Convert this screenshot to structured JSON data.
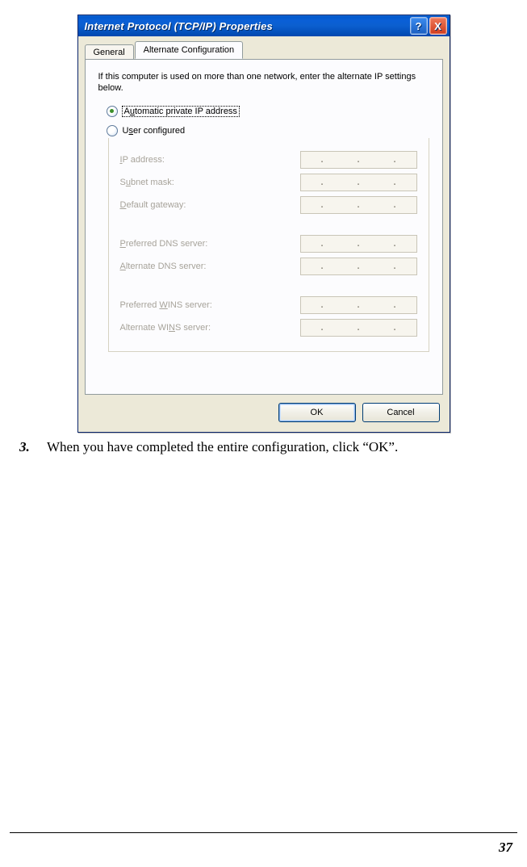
{
  "dialog": {
    "title": "Internet Protocol (TCP/IP) Properties",
    "help_btn": "?",
    "close_btn": "X",
    "tabs": {
      "general": "General",
      "alt": "Alternate Configuration"
    },
    "intro": "If this computer is used on more than one network, enter the alternate IP settings below.",
    "radio": {
      "auto": "Automatic private IP address",
      "user": "User configured"
    },
    "fields": {
      "ip": "IP address:",
      "subnet": "Subnet mask:",
      "gateway": "Default gateway:",
      "pdns": "Preferred DNS server:",
      "adns": "Alternate DNS server:",
      "pwins": "Preferred WINS server:",
      "awins": "Alternate WINS server:"
    },
    "ip_dots": ".",
    "buttons": {
      "ok": "OK",
      "cancel": "Cancel"
    }
  },
  "instruction": {
    "num": "3.",
    "text": "When you have completed the entire configuration, click “OK”."
  },
  "page_number": "37"
}
